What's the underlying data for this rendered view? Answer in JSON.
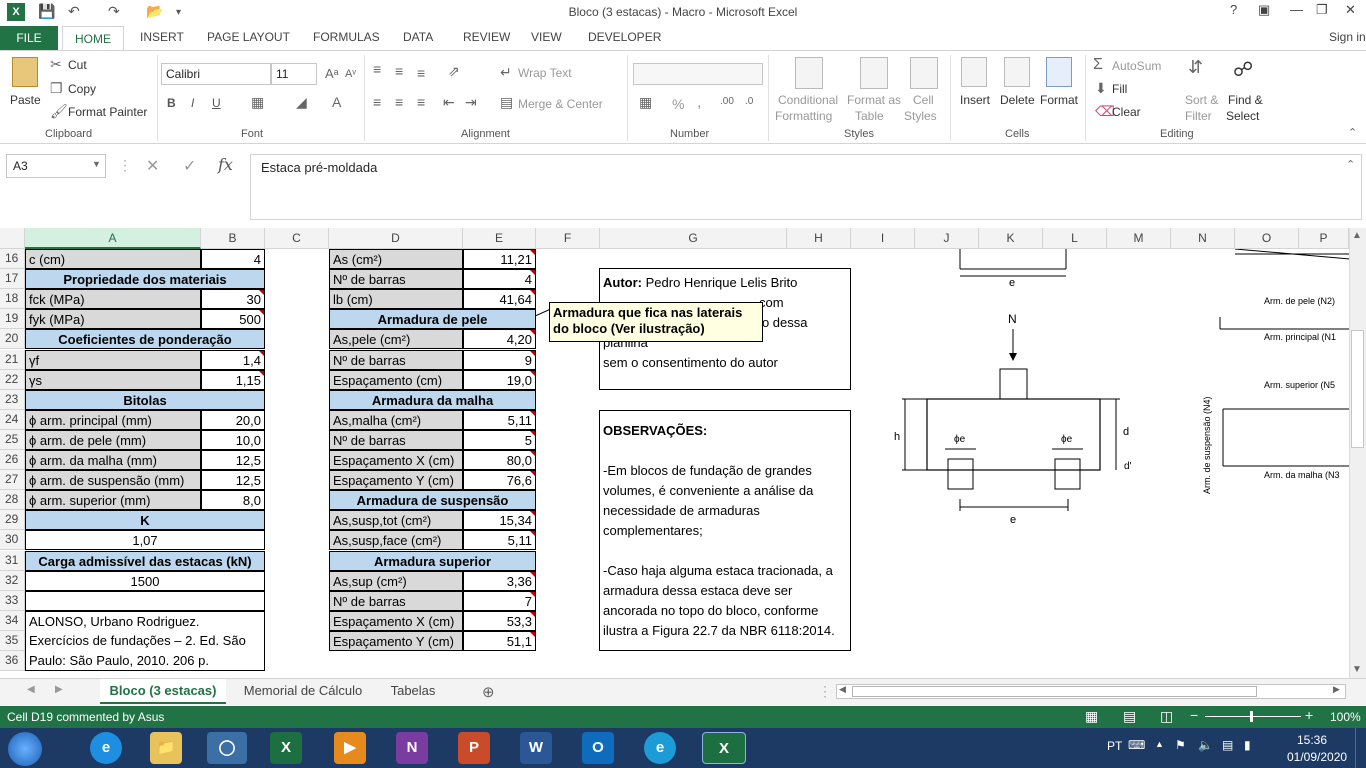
{
  "window": {
    "title": "Bloco (3 estacas) - Macro - Microsoft Excel",
    "help": "?",
    "signin": "Sign in"
  },
  "ribbon_tabs": [
    "FILE",
    "HOME",
    "INSERT",
    "PAGE LAYOUT",
    "FORMULAS",
    "DATA",
    "REVIEW",
    "VIEW",
    "DEVELOPER"
  ],
  "clipboard": {
    "paste": "Paste",
    "cut": "Cut",
    "copy": "Copy",
    "format_painter": "Format Painter",
    "label": "Clipboard"
  },
  "font": {
    "name": "Calibri",
    "size": "11",
    "bold": "B",
    "italic": "I",
    "underline": "U",
    "label": "Font"
  },
  "alignment": {
    "wrap": "Wrap Text",
    "merge": "Merge & Center",
    "label": "Alignment"
  },
  "number": {
    "percent": "%",
    "comma": ",",
    "label": "Number"
  },
  "styles": {
    "conditional": "Conditional",
    "conditional2": "Formatting",
    "format_as": "Format as",
    "format_as2": "Table",
    "cell": "Cell",
    "cell2": "Styles",
    "label": "Styles"
  },
  "cells": {
    "insert": "Insert",
    "delete": "Delete",
    "format": "Format",
    "label": "Cells"
  },
  "editing": {
    "autosum": "AutoSum",
    "fill": "Fill",
    "clear": "Clear",
    "sort": "Sort &",
    "sort2": "Filter",
    "find": "Find &",
    "find2": "Select",
    "label": "Editing"
  },
  "formula_bar": {
    "name_box": "A3",
    "fx": "fx",
    "content": "Estaca pré-moldada"
  },
  "columns": [
    "A",
    "B",
    "C",
    "D",
    "E",
    "F",
    "G",
    "H",
    "I",
    "J",
    "K",
    "L",
    "M",
    "N",
    "O",
    "P"
  ],
  "rows": [
    "16",
    "17",
    "18",
    "19",
    "20",
    "21",
    "22",
    "23",
    "24",
    "25",
    "26",
    "27",
    "28",
    "29",
    "30",
    "31",
    "32",
    "33",
    "34",
    "35",
    "36"
  ],
  "colA": {
    "r16": "c (cm)",
    "r17": "Propriedade dos materiais",
    "r18": "fck (MPa)",
    "r19": "fyk (MPa)",
    "r20": "Coeficientes de ponderação",
    "r21": "γf",
    "r22": "γs",
    "r23": "Bitolas",
    "r24": "ϕ arm. principal (mm)",
    "r25": "ϕ arm. de pele (mm)",
    "r26": "ϕ arm. da malha (mm)",
    "r27": "ϕ arm. de suspensão (mm)",
    "r28": "ϕ arm. superior (mm)",
    "r29": "K",
    "r30": "1,07",
    "r31": "Carga admissível das estacas (kN)",
    "r32": "1500",
    "r34": "ALONSO, Urbano Rodriguez.",
    "r35": "Exercícios de fundações – 2. Ed. São",
    "r36": "Paulo: São Paulo, 2010. 206 p."
  },
  "colB": {
    "r16": "4",
    "r18": "30",
    "r19": "500",
    "r21": "1,4",
    "r22": "1,15",
    "r24": "20,0",
    "r25": "10,0",
    "r26": "12,5",
    "r27": "12,5",
    "r28": "8,0"
  },
  "colD": {
    "r16": "As (cm²)",
    "r17": "Nº de barras",
    "r18": "lb (cm)",
    "r19": "Armadura de pele",
    "r20": "As,pele (cm²)",
    "r21": "Nº de barras",
    "r22": "Espaçamento (cm)",
    "r23": "Armadura da malha",
    "r24": "As,malha (cm²)",
    "r25": "Nº de barras",
    "r26": "Espaçamento X (cm)",
    "r27": "Espaçamento Y (cm)",
    "r28": "Armadura de suspensão",
    "r29": "As,susp,tot (cm²)",
    "r30": "As,susp,face (cm²)",
    "r31": "Armadura superior",
    "r32": "As,sup (cm²)",
    "r33": "Nº de barras",
    "r34": "Espaçamento X (cm)",
    "r35": "Espaçamento Y (cm)"
  },
  "colE": {
    "r16": "11,21",
    "r17": "4",
    "r18": "41,64",
    "r20": "4,20",
    "r21": "9",
    "r22": "19,0",
    "r24": "5,11",
    "r25": "5",
    "r26": "80,0",
    "r27": "76,6",
    "r29": "15,34",
    "r30": "5,11",
    "r32": "3,36",
    "r33": "7",
    "r34": "53,3",
    "r35": "51,1"
  },
  "author_box": {
    "label": "Autor:",
    "name": "Pedro Henrique Lelis Brito",
    "line2": "com",
    "line3": "É proibida a comercialização dessa planilha",
    "line4": "sem o consentimento do autor"
  },
  "comment": "Armadura que fica nas laterais do bloco (Ver ilustração)",
  "obs_box": {
    "title": "OBSERVAÇÕES:",
    "p1": [
      "-Em blocos de fundação de grandes",
      "volumes, é conveniente a análise da",
      "necessidade de armaduras",
      "complementares;"
    ],
    "p2": [
      "-Caso haja alguma estaca tracionada, a",
      "armadura dessa estaca deve ser",
      "ancorada no topo do bloco, conforme",
      "ilustra a Figura 22.7 da NBR 6118:2014."
    ]
  },
  "drawing": {
    "e": "e",
    "N": "N",
    "h": "h",
    "d": "d",
    "dprime": "d'",
    "phi": "ϕe",
    "arm_pele": "Arm. de pele (N2)",
    "arm_principal": "Arm. principal (N1",
    "arm_superior": "Arm. superior (N5",
    "arm_susp": "Arm. de suspensão (N4)",
    "arm_malha": "Arm. da malha (N3"
  },
  "sheets": [
    "Bloco (3 estacas)",
    "Memorial de Cálculo",
    "Tabelas"
  ],
  "status": {
    "left": "Cell D19 commented by Asus",
    "zoom": "100%"
  },
  "taskbar": {
    "lang": "PT",
    "time": "15:36",
    "date": "01/09/2020"
  }
}
